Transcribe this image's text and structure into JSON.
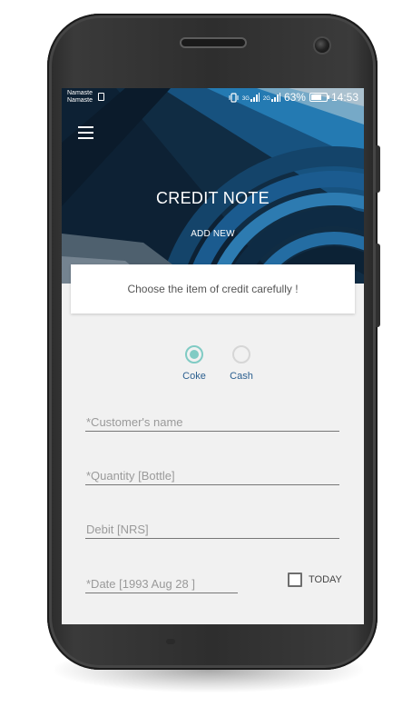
{
  "status_bar": {
    "carrier_line1": "Namaste",
    "carrier_line2": "Namaste",
    "network_1": "3G",
    "network_2": "2G",
    "battery": "63%",
    "time": "14:53"
  },
  "header": {
    "title": "CREDIT NOTE",
    "subtitle": "ADD NEW"
  },
  "hint": {
    "text": "Choose the item of credit carefully !"
  },
  "item_choice": {
    "selected": "Coke",
    "options": [
      "Coke",
      "Cash"
    ]
  },
  "form": {
    "customer_name": {
      "placeholder": "*Customer's name",
      "value": ""
    },
    "quantity": {
      "placeholder": "*Quantity [Bottle]",
      "value": ""
    },
    "debit": {
      "placeholder": "Debit [NRS]",
      "value": ""
    },
    "date": {
      "placeholder": "*Date [1993 Aug 28 ]",
      "value": ""
    },
    "today_label": "TODAY",
    "today_checked": false
  },
  "colors": {
    "accent_radio": "#80cbc4",
    "label_blue": "#2b5f8f",
    "header_dark": "#0e2336",
    "header_blue": "#1a78b8"
  }
}
